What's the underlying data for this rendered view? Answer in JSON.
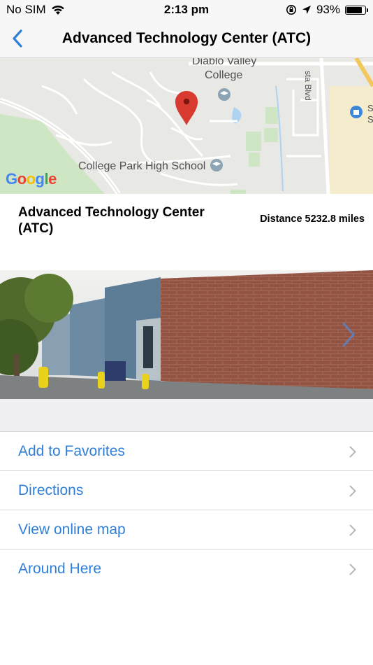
{
  "status_bar": {
    "carrier": "No SIM",
    "time": "2:13 pm",
    "battery_percent": "93%",
    "battery_level": 0.93
  },
  "nav": {
    "title": "Advanced Technology Center (ATC)"
  },
  "map": {
    "labels": [
      "Diablo Valley",
      "College",
      "College Park High School",
      "sta Blvd",
      "S",
      "S"
    ],
    "provider": "Google"
  },
  "info": {
    "title": "Advanced Technology Center (ATC)",
    "distance": "Distance 5232.8 miles"
  },
  "actions": [
    {
      "label": "Add to Favorites"
    },
    {
      "label": "Directions"
    },
    {
      "label": "View online map"
    },
    {
      "label": "Around Here"
    }
  ],
  "colors": {
    "accent": "#2f7fd8",
    "pin": "#d93a30",
    "separator": "#d9d9d9"
  }
}
